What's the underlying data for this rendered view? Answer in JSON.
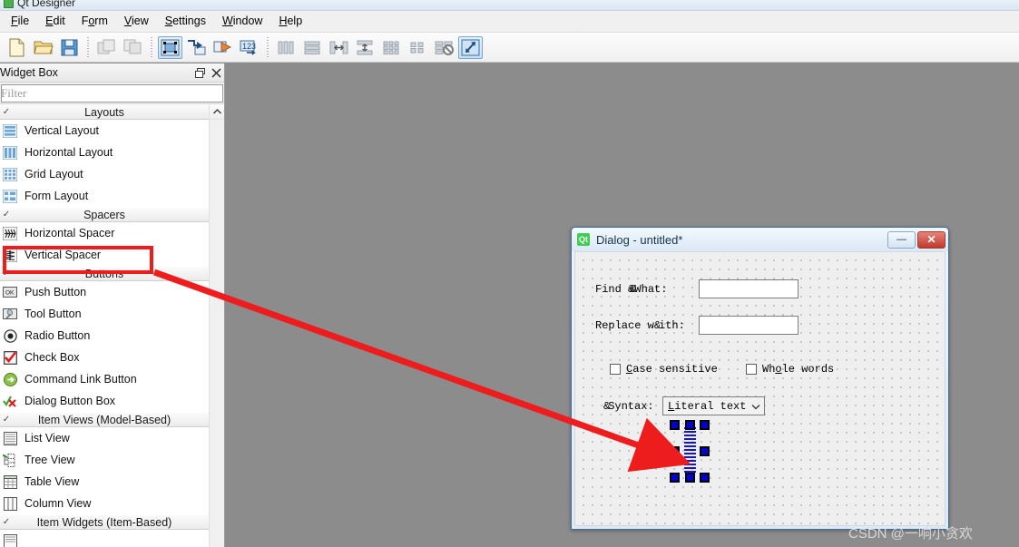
{
  "window": {
    "title": "Qt Designer",
    "app_icon": "qt-designer-icon"
  },
  "menubar": {
    "items": [
      {
        "label": "File",
        "mnemonic": "F"
      },
      {
        "label": "Edit",
        "mnemonic": "E"
      },
      {
        "label": "Form",
        "mnemonic": "o"
      },
      {
        "label": "View",
        "mnemonic": "V"
      },
      {
        "label": "Settings",
        "mnemonic": "S"
      },
      {
        "label": "Window",
        "mnemonic": "W"
      },
      {
        "label": "Help",
        "mnemonic": "H"
      }
    ]
  },
  "toolbar": {
    "groups": [
      {
        "name": "file",
        "buttons": [
          {
            "icon": "new-form-icon",
            "label": "New",
            "active": false,
            "enabled": true
          },
          {
            "icon": "open-form-icon",
            "label": "Open",
            "active": false,
            "enabled": true
          },
          {
            "icon": "save-form-icon",
            "label": "Save",
            "active": false,
            "enabled": true
          }
        ]
      },
      {
        "name": "edit",
        "buttons": [
          {
            "icon": "undo-icon",
            "label": "Undo",
            "active": false,
            "enabled": false
          },
          {
            "icon": "redo-icon",
            "label": "Redo",
            "active": false,
            "enabled": false
          }
        ]
      },
      {
        "name": "mode",
        "buttons": [
          {
            "icon": "edit-widgets-icon",
            "label": "Edit Widgets",
            "active": true,
            "enabled": true
          },
          {
            "icon": "edit-signals-icon",
            "label": "Edit Signals/Slots",
            "active": false,
            "enabled": true
          },
          {
            "icon": "edit-buddies-icon",
            "label": "Edit Buddies",
            "active": false,
            "enabled": true
          },
          {
            "icon": "edit-tab-order-icon",
            "label": "Edit Tab Order",
            "active": false,
            "enabled": true
          }
        ]
      },
      {
        "name": "layout",
        "buttons": [
          {
            "icon": "layout-horizontal-icon",
            "label": "Lay Out Horizontally",
            "active": false,
            "enabled": false
          },
          {
            "icon": "layout-vertical-icon",
            "label": "Lay Out Vertically",
            "active": false,
            "enabled": false
          },
          {
            "icon": "layout-splitter-h-icon",
            "label": "Lay Out Horizontally in Splitter",
            "active": false,
            "enabled": false
          },
          {
            "icon": "layout-splitter-v-icon",
            "label": "Lay Out Vertically in Splitter",
            "active": false,
            "enabled": false
          },
          {
            "icon": "layout-grid-icon",
            "label": "Lay Out in a Grid",
            "active": false,
            "enabled": false
          },
          {
            "icon": "layout-form-icon",
            "label": "Lay Out in a Form Layout",
            "active": false,
            "enabled": false
          },
          {
            "icon": "break-layout-icon",
            "label": "Break Layout",
            "active": false,
            "enabled": false
          },
          {
            "icon": "adjust-size-icon",
            "label": "Adjust Size",
            "active": true,
            "enabled": true
          }
        ]
      }
    ]
  },
  "widget_box": {
    "title": "Widget Box",
    "float_button": "float-icon",
    "close_button": "close-icon",
    "filter": {
      "value": "",
      "placeholder": "Filter"
    },
    "scroll": {
      "up_arrow": "chevron-up-icon"
    },
    "sections": [
      {
        "label": "Layouts",
        "expanded": true,
        "items": [
          {
            "label": "Vertical Layout",
            "icon": "vertical-layout-icon"
          },
          {
            "label": "Horizontal Layout",
            "icon": "horizontal-layout-icon"
          },
          {
            "label": "Grid Layout",
            "icon": "grid-layout-icon"
          },
          {
            "label": "Form Layout",
            "icon": "form-layout-icon"
          }
        ]
      },
      {
        "label": "Spacers",
        "expanded": true,
        "items": [
          {
            "label": "Horizontal Spacer",
            "icon": "horizontal-spacer-icon"
          },
          {
            "label": "Vertical Spacer",
            "icon": "vertical-spacer-icon",
            "highlighted": true
          }
        ]
      },
      {
        "label": "Buttons",
        "expanded": true,
        "items": [
          {
            "label": "Push Button",
            "icon": "push-button-icon"
          },
          {
            "label": "Tool Button",
            "icon": "tool-button-icon"
          },
          {
            "label": "Radio Button",
            "icon": "radio-button-icon"
          },
          {
            "label": "Check Box",
            "icon": "check-box-icon"
          },
          {
            "label": "Command Link Button",
            "icon": "command-link-button-icon"
          },
          {
            "label": "Dialog Button Box",
            "icon": "dialog-button-box-icon"
          }
        ]
      },
      {
        "label": "Item Views (Model-Based)",
        "expanded": true,
        "items": [
          {
            "label": "List View",
            "icon": "list-view-icon"
          },
          {
            "label": "Tree View",
            "icon": "tree-view-icon"
          },
          {
            "label": "Table View",
            "icon": "table-view-icon"
          },
          {
            "label": "Column View",
            "icon": "column-view-icon"
          }
        ]
      },
      {
        "label": "Item Widgets (Item-Based)",
        "expanded": true,
        "items": []
      }
    ]
  },
  "dialog": {
    "title": "Dialog - untitled*",
    "logo_text": "Qt",
    "buttons": [
      {
        "name": "minimize-button",
        "glyph": "—"
      },
      {
        "name": "close-button",
        "glyph": "✕"
      }
    ],
    "fields": [
      {
        "label_prefix": "Find ",
        "label_amp": "&&",
        "label_suffix": "What:",
        "value": "",
        "name": "find-what"
      },
      {
        "label_prefix": "Replace w",
        "label_amp": "&",
        "label_suffix": "ith:",
        "value": "",
        "name": "replace-with"
      }
    ],
    "checkboxes": [
      {
        "label_head": "C",
        "label_tail": "ase sensitive",
        "checked": false,
        "name": "case-sensitive"
      },
      {
        "label_head": "Wh",
        "label_mid": "o",
        "label_tail": "le words",
        "checked": false,
        "name": "whole-words"
      }
    ],
    "syntax": {
      "label": "&Syntax:",
      "label_prefix": "&",
      "label_text": "Syntax:",
      "value": "Literal text",
      "arrow": "chevron-down-icon"
    },
    "spacer": {
      "name": "vertical-spacer-widget",
      "selected": true,
      "handle_count": 8
    }
  },
  "annotations": {
    "highlight_box": {
      "target": "Vertical Spacer",
      "color": "#ee1d1d"
    },
    "arrow": {
      "color": "#ee1d1d",
      "from": "Vertical Spacer",
      "to": "vertical-spacer-widget"
    }
  },
  "watermark": {
    "text": "CSDN @一响小贪欢"
  }
}
